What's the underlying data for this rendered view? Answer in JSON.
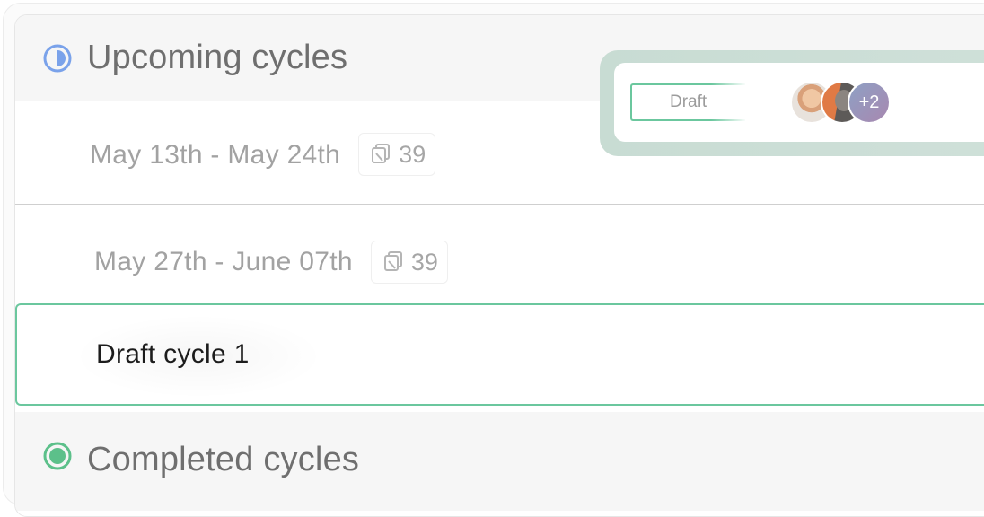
{
  "upcoming": {
    "title": "Upcoming cycles",
    "icon": "half-circle-status-icon",
    "icon_color": "#7aa2ea"
  },
  "cycles": [
    {
      "date_range": "May 13th - May 24th",
      "issue_count": "39"
    },
    {
      "date_range": "May 27th - June 07th",
      "issue_count": "39"
    }
  ],
  "draft": {
    "title": "Draft cycle 1",
    "border_color": "#6bc79e"
  },
  "popover": {
    "status_label": "Draft",
    "avatars": [
      "member-avatar",
      "member-avatar",
      "more-members-avatar"
    ],
    "more_count": "+2"
  },
  "completed": {
    "title": "Completed cycles",
    "icon": "completed-status-icon",
    "icon_color": "#5cc08a"
  }
}
